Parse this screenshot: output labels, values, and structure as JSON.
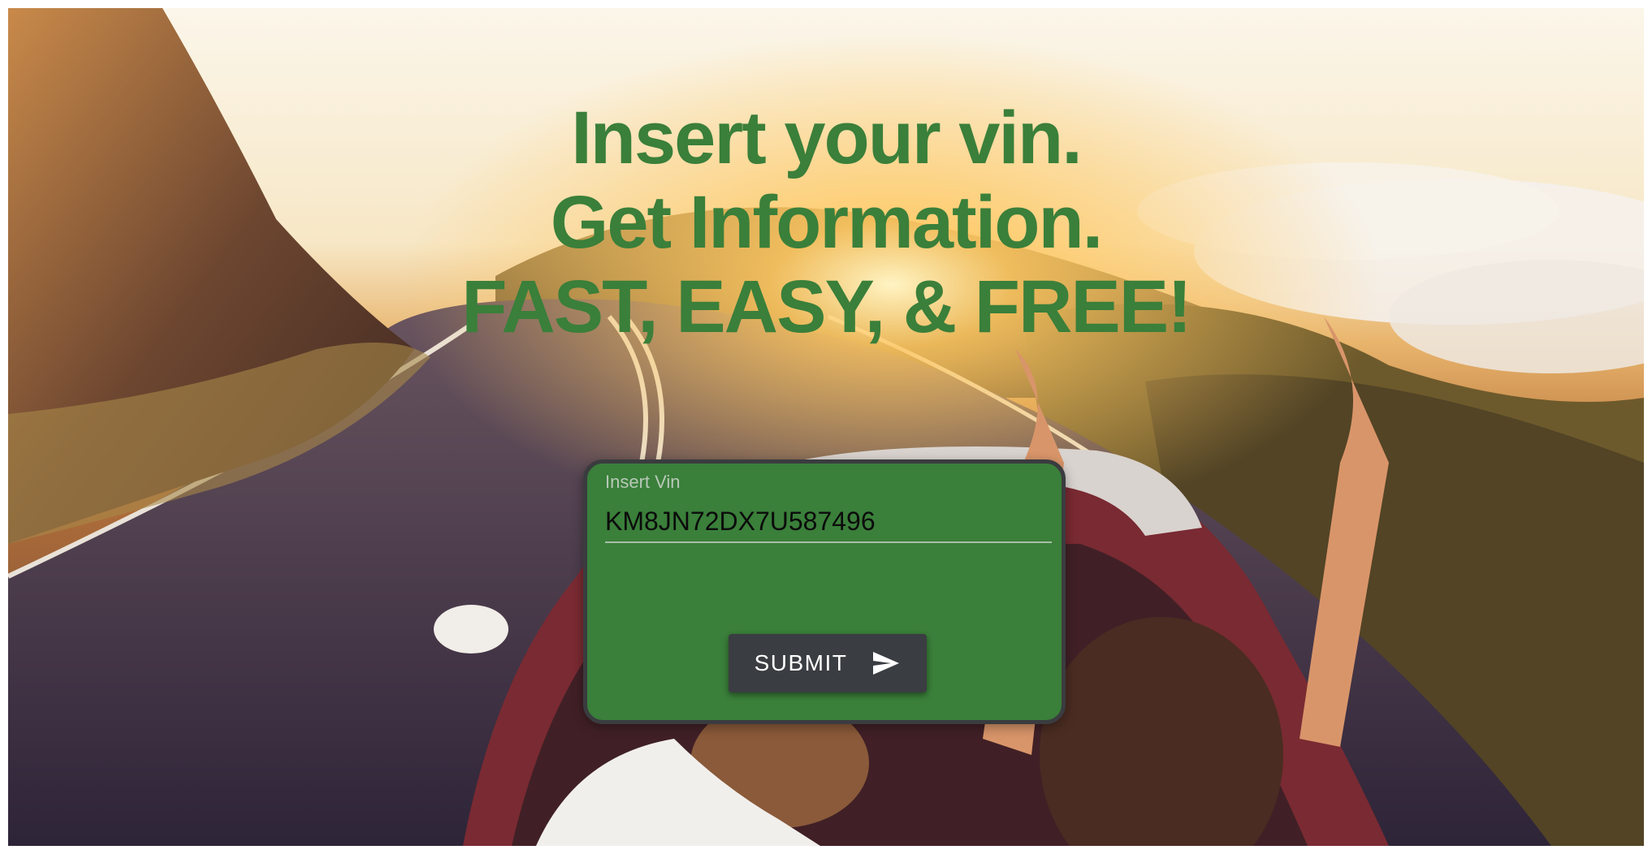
{
  "hero": {
    "headline_lines": [
      "Insert your vin.",
      "Get Information.",
      "FAST, EASY, & FREE!"
    ],
    "accent_color": "#3a7f3a"
  },
  "vin_form": {
    "label": "Insert Vin",
    "value": "KM8JN72DX7U587496",
    "submit_label": "SUBMIT",
    "submit_icon": "send-icon",
    "card_color": "#3a7f3a",
    "button_color": "#3a3d41"
  }
}
